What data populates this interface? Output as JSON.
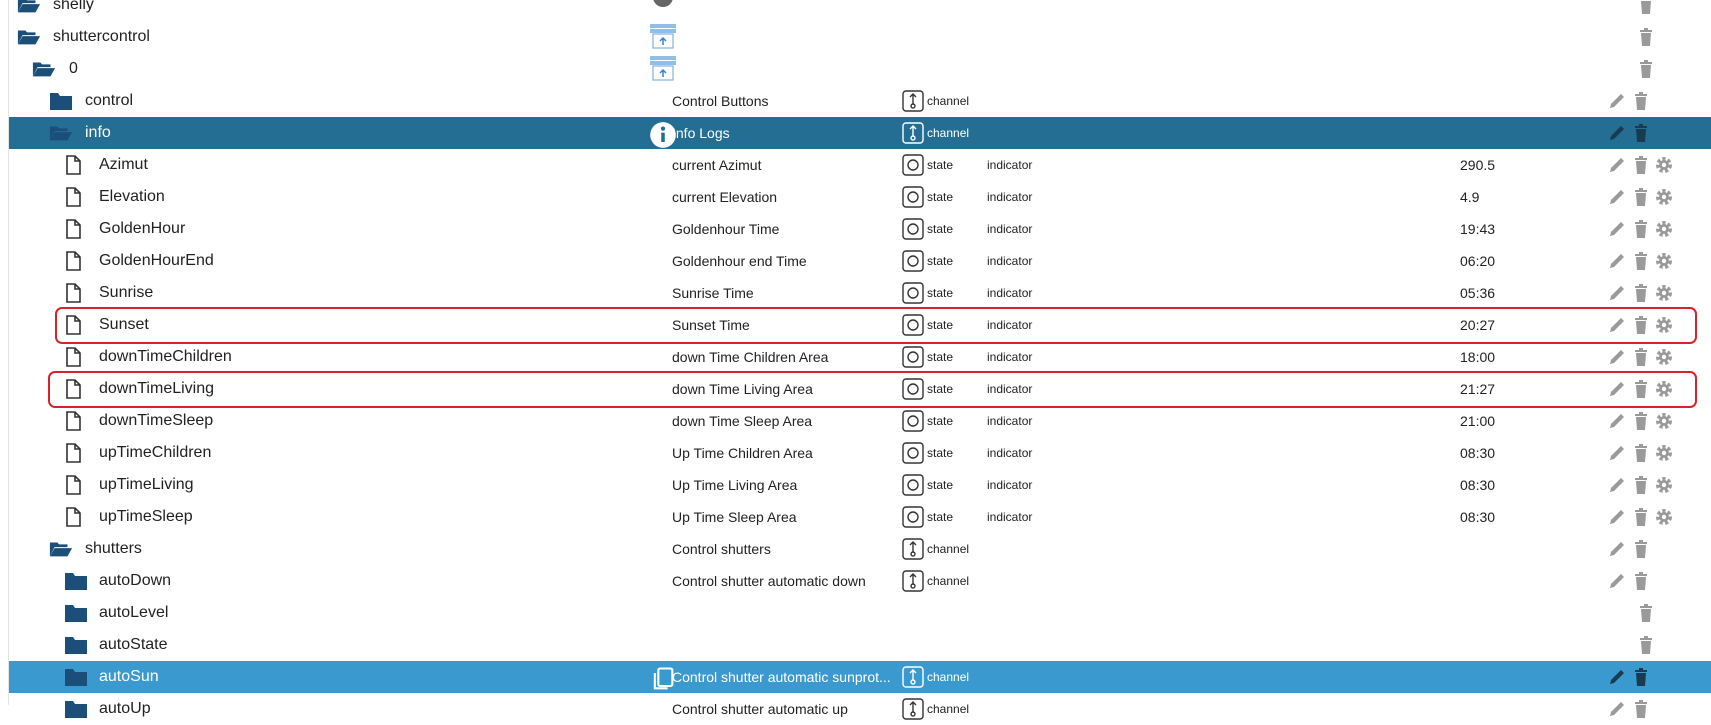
{
  "colors": {
    "selected_dark": "#236e92",
    "selected_light": "#3a9ad0",
    "folder": "#1b4f7a",
    "highlight": "#d9232b",
    "action_gray": "#9a9a9a"
  },
  "rows": [
    {
      "name": "shelly",
      "desc": "",
      "type": "",
      "role": "",
      "value": "",
      "icon": "folder-open",
      "indent": 1,
      "actions": [
        "delete"
      ]
    },
    {
      "name": "shuttercontrol",
      "desc": "",
      "type": "",
      "role": "",
      "value": "",
      "icon": "folder-open",
      "indent": 1,
      "actions": [
        "delete"
      ]
    },
    {
      "name": "0",
      "desc": "",
      "type": "",
      "role": "",
      "value": "",
      "icon": "folder-open",
      "indent": 2,
      "actions": [
        "delete"
      ]
    },
    {
      "name": "control",
      "desc": "Control Buttons",
      "type": "channel",
      "role": "",
      "value": "",
      "icon": "folder",
      "indent": 3,
      "actions": [
        "edit",
        "delete"
      ]
    },
    {
      "name": "info",
      "desc": "Info Logs",
      "type": "channel",
      "role": "",
      "value": "",
      "icon": "folder-open",
      "indent": 3,
      "actions": [
        "edit",
        "delete"
      ],
      "selected": "dark"
    },
    {
      "name": "Azimut",
      "desc": "current Azimut",
      "type": "state",
      "role": "indicator",
      "value": "290.5",
      "icon": "file",
      "indent": 4,
      "actions": [
        "edit",
        "delete",
        "settings"
      ]
    },
    {
      "name": "Elevation",
      "desc": "current Elevation",
      "type": "state",
      "role": "indicator",
      "value": "4.9",
      "icon": "file",
      "indent": 4,
      "actions": [
        "edit",
        "delete",
        "settings"
      ]
    },
    {
      "name": "GoldenHour",
      "desc": "Goldenhour Time",
      "type": "state",
      "role": "indicator",
      "value": "19:43",
      "icon": "file",
      "indent": 4,
      "actions": [
        "edit",
        "delete",
        "settings"
      ]
    },
    {
      "name": "GoldenHourEnd",
      "desc": "Goldenhour end Time",
      "type": "state",
      "role": "indicator",
      "value": "06:20",
      "icon": "file",
      "indent": 4,
      "actions": [
        "edit",
        "delete",
        "settings"
      ]
    },
    {
      "name": "Sunrise",
      "desc": "Sunrise Time",
      "type": "state",
      "role": "indicator",
      "value": "05:36",
      "icon": "file",
      "indent": 4,
      "actions": [
        "edit",
        "delete",
        "settings"
      ]
    },
    {
      "name": "Sunset",
      "desc": "Sunset Time",
      "type": "state",
      "role": "indicator",
      "value": "20:27",
      "icon": "file",
      "indent": 4,
      "actions": [
        "edit",
        "delete",
        "settings"
      ]
    },
    {
      "name": "downTimeChildren",
      "desc": "down Time Children Area",
      "type": "state",
      "role": "indicator",
      "value": "18:00",
      "icon": "file",
      "indent": 4,
      "actions": [
        "edit",
        "delete",
        "settings"
      ]
    },
    {
      "name": "downTimeLiving",
      "desc": "down Time Living Area",
      "type": "state",
      "role": "indicator",
      "value": "21:27",
      "icon": "file",
      "indent": 4,
      "actions": [
        "edit",
        "delete",
        "settings"
      ]
    },
    {
      "name": "downTimeSleep",
      "desc": "down Time Sleep Area",
      "type": "state",
      "role": "indicator",
      "value": "21:00",
      "icon": "file",
      "indent": 4,
      "actions": [
        "edit",
        "delete",
        "settings"
      ]
    },
    {
      "name": "upTimeChildren",
      "desc": "Up Time Children Area",
      "type": "state",
      "role": "indicator",
      "value": "08:30",
      "icon": "file",
      "indent": 4,
      "actions": [
        "edit",
        "delete",
        "settings"
      ]
    },
    {
      "name": "upTimeLiving",
      "desc": "Up Time Living Area",
      "type": "state",
      "role": "indicator",
      "value": "08:30",
      "icon": "file",
      "indent": 4,
      "actions": [
        "edit",
        "delete",
        "settings"
      ]
    },
    {
      "name": "upTimeSleep",
      "desc": "Up Time Sleep Area",
      "type": "state",
      "role": "indicator",
      "value": "08:30",
      "icon": "file",
      "indent": 4,
      "actions": [
        "edit",
        "delete",
        "settings"
      ]
    },
    {
      "name": "shutters",
      "desc": "Control shutters",
      "type": "channel",
      "role": "",
      "value": "",
      "icon": "folder-open",
      "indent": 3,
      "actions": [
        "edit",
        "delete"
      ]
    },
    {
      "name": "autoDown",
      "desc": "Control shutter automatic down",
      "type": "channel",
      "role": "",
      "value": "",
      "icon": "folder",
      "indent": 4,
      "actions": [
        "edit",
        "delete"
      ]
    },
    {
      "name": "autoLevel",
      "desc": "",
      "type": "",
      "role": "",
      "value": "",
      "icon": "folder",
      "indent": 4,
      "actions": [
        "delete"
      ]
    },
    {
      "name": "autoState",
      "desc": "",
      "type": "",
      "role": "",
      "value": "",
      "icon": "folder",
      "indent": 4,
      "actions": [
        "delete"
      ]
    },
    {
      "name": "autoSun",
      "desc": "Control shutter automatic sunprot...",
      "type": "channel",
      "role": "",
      "value": "",
      "icon": "folder",
      "indent": 4,
      "actions": [
        "edit",
        "delete"
      ],
      "selected": "light"
    },
    {
      "name": "autoUp",
      "desc": "Control shutter automatic up",
      "type": "channel",
      "role": "",
      "value": "",
      "icon": "folder",
      "indent": 4,
      "actions": [
        "edit",
        "delete"
      ]
    }
  ],
  "row_icons": {
    "shelly": "shelly-logo-icon",
    "shuttercontrol": "shutter-adapter-icon",
    "0": "shutter-adapter-icon",
    "info": "info-icon",
    "autoSun": "copy-icon"
  },
  "highlighted_rows": [
    "Sunset",
    "downTimeLiving"
  ]
}
